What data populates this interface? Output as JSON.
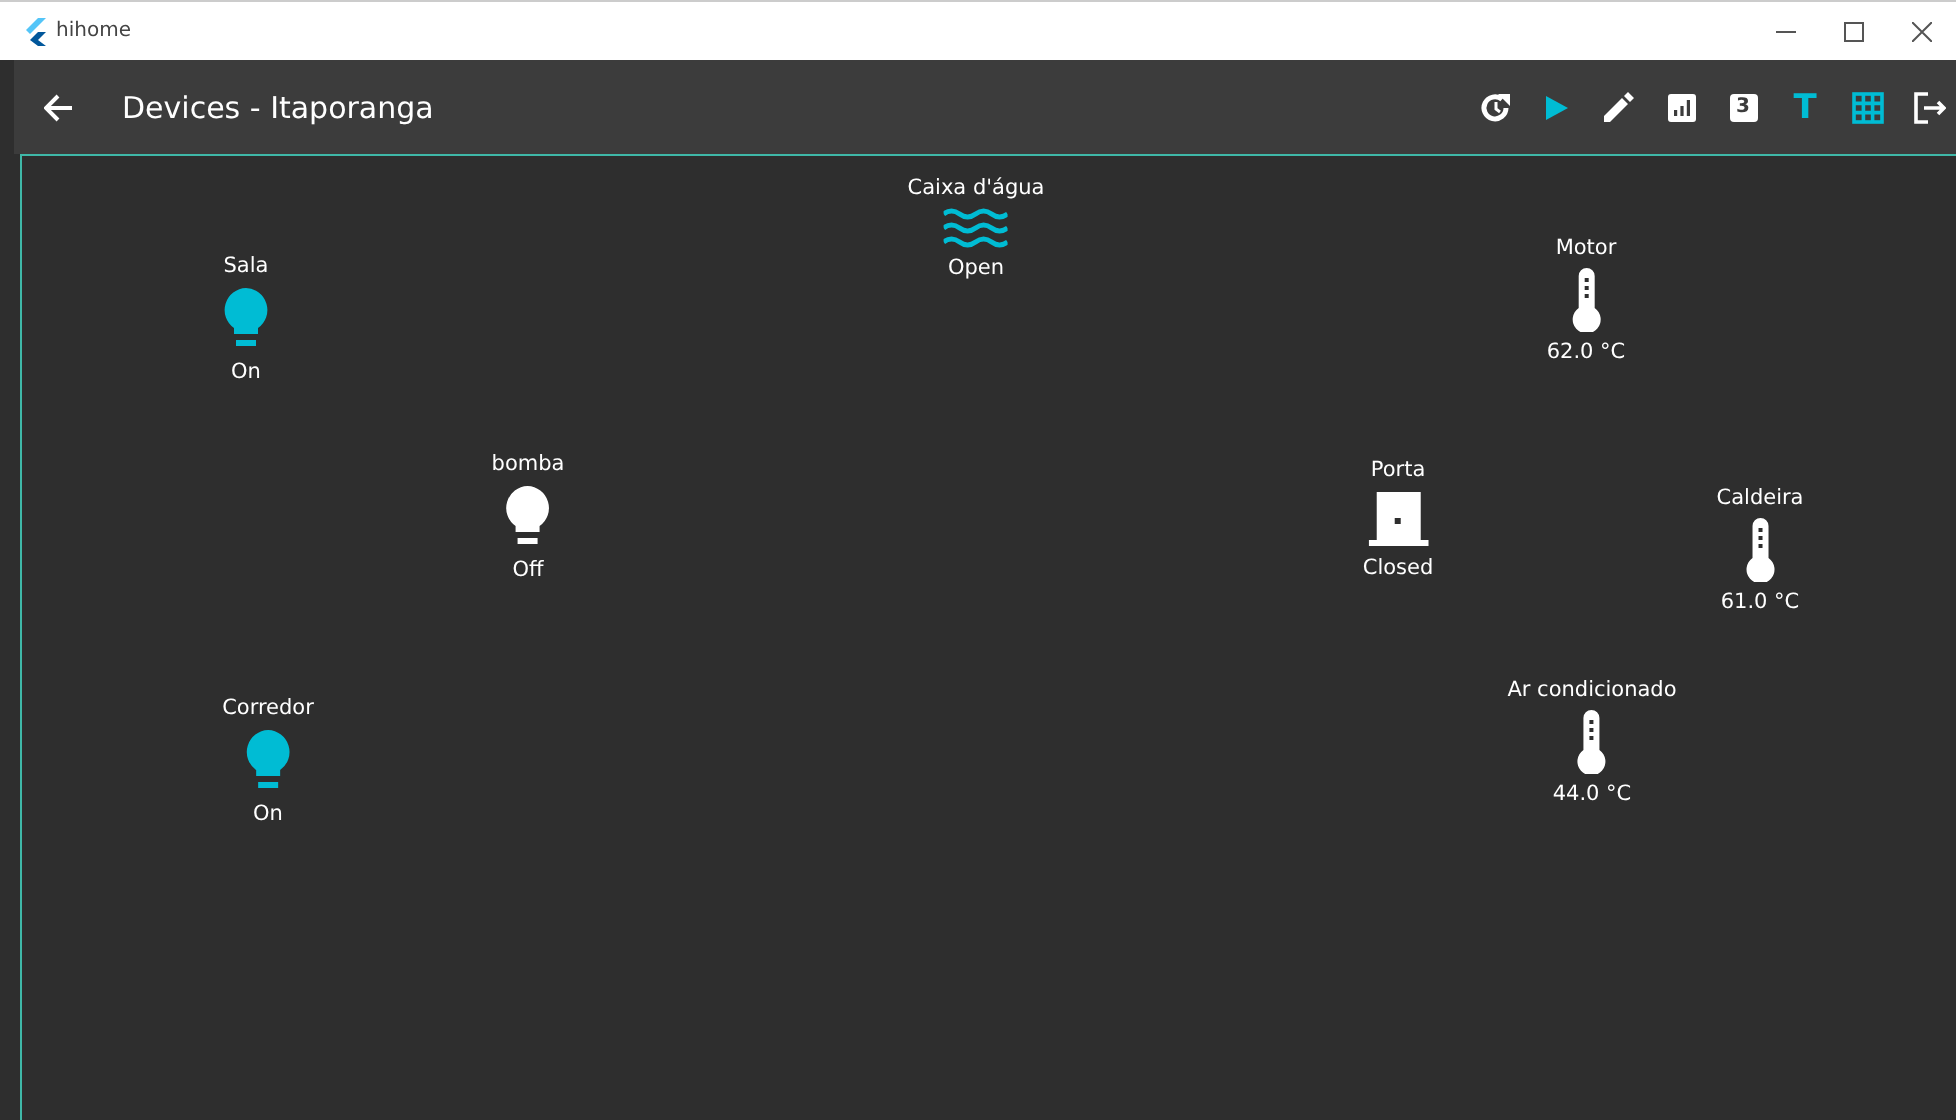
{
  "window": {
    "title": "hihome"
  },
  "app_bar": {
    "title": "Devices - Itaporanga",
    "actions": [
      {
        "kind": "history",
        "selected": false
      },
      {
        "kind": "play",
        "selected": true
      },
      {
        "kind": "edit",
        "selected": false
      },
      {
        "kind": "chart",
        "selected": false
      },
      {
        "kind": "badge",
        "label": "3",
        "selected": false
      },
      {
        "kind": "letter",
        "label": "T",
        "selected": true
      },
      {
        "kind": "grid",
        "selected": true
      },
      {
        "kind": "exit",
        "selected": false
      }
    ]
  },
  "devices": [
    {
      "kind": "light",
      "name": "Sala",
      "status": "On",
      "on": true
    },
    {
      "kind": "water",
      "name": "Caixa d'água",
      "status": "Open",
      "on": true
    },
    {
      "kind": "thermometer",
      "name": "Motor",
      "status": "62.0 °C",
      "on": false
    },
    {
      "kind": "light",
      "name": "bomba",
      "status": "Off",
      "on": false
    },
    {
      "kind": "door",
      "name": "Porta",
      "status": "Closed",
      "on": false
    },
    {
      "kind": "thermometer",
      "name": "Caldeira",
      "status": "61.0 °C",
      "on": false
    },
    {
      "kind": "thermometer",
      "name": "Ar condicionado",
      "status": "44.0 °C",
      "on": false
    },
    {
      "kind": "light",
      "name": "Corredor",
      "status": "On",
      "on": true
    }
  ]
}
